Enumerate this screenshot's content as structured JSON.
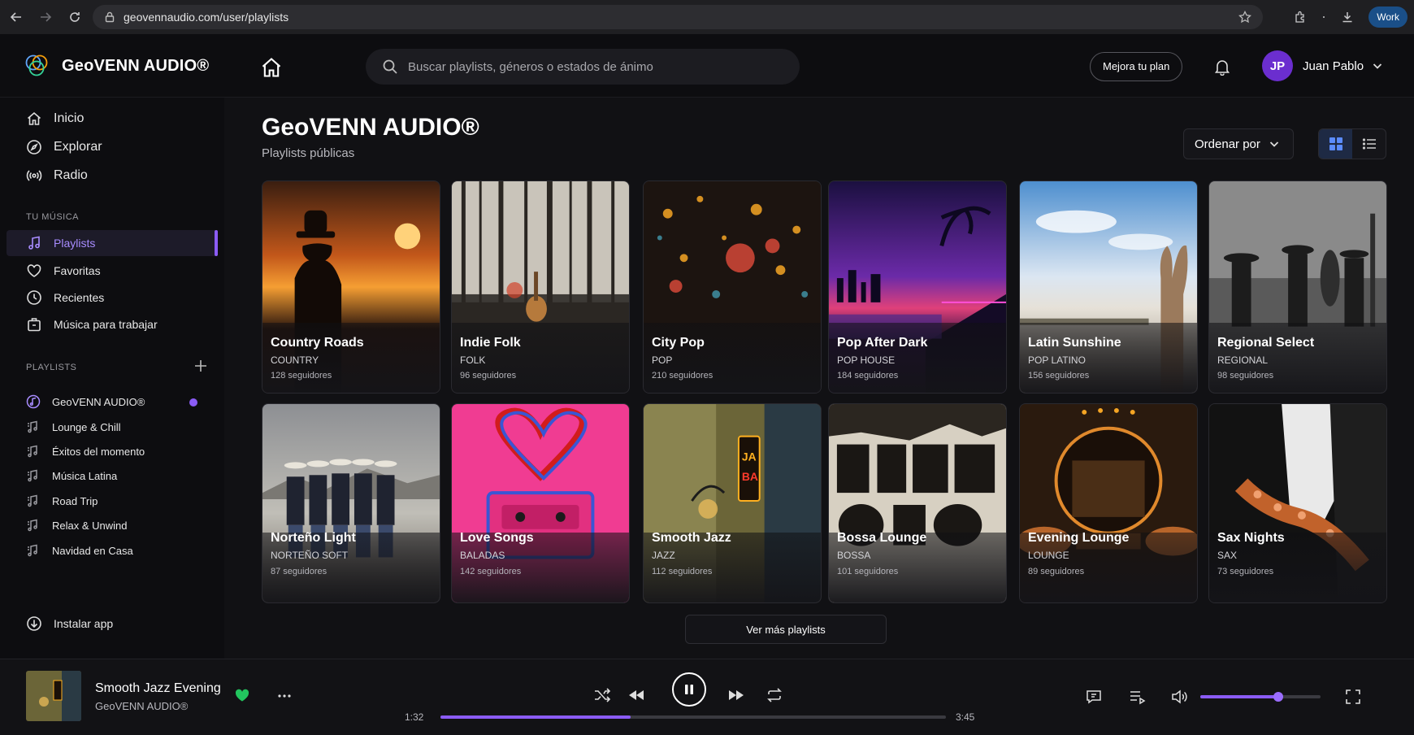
{
  "browser": {
    "url": "geovennaudio.com/user/playlists",
    "profile_label": "Work"
  },
  "header": {
    "brand": "GeoVENN AUDIO®",
    "search_placeholder": "Buscar playlists, géneros o estados de ánimo",
    "upgrade_label": "Mejora tu plan",
    "user_initials": "JP",
    "user_name": "Juan Pablo"
  },
  "sidebar": {
    "nav": [
      {
        "label": "Inicio",
        "icon": "home-icon"
      },
      {
        "label": "Explorar",
        "icon": "compass-icon"
      },
      {
        "label": "Radio",
        "icon": "radio-icon"
      }
    ],
    "section_music": "TU MÚSICA",
    "music": [
      {
        "label": "Playlists",
        "icon": "music-note-icon",
        "active": true
      },
      {
        "label": "Favoritas",
        "icon": "heart-icon"
      },
      {
        "label": "Recientes",
        "icon": "clock-icon"
      },
      {
        "label": "Música para trabajar",
        "icon": "briefcase-icon"
      }
    ],
    "section_playlists": "PLAYLISTS",
    "playlists": [
      "GeoVENN AUDIO®",
      "Lounge & Chill",
      "Éxitos del momento",
      "Música Latina",
      "Road Trip",
      "Relax & Unwind",
      "Navidad en Casa"
    ],
    "install_label": "Instalar app"
  },
  "main": {
    "title": "GeoVENN AUDIO®",
    "subtitle": "Playlists públicas",
    "sort_label": "Ordenar por",
    "more_label": "Ver más playlists",
    "cards": [
      {
        "title": "Country Roads",
        "genre": "COUNTRY",
        "followers": "128 seguidores"
      },
      {
        "title": "Indie Folk",
        "genre": "FOLK",
        "followers": "96 seguidores"
      },
      {
        "title": "City Pop",
        "genre": "POP",
        "followers": "210 seguidores"
      },
      {
        "title": "Pop After Dark",
        "genre": "POP HOUSE",
        "followers": "184 seguidores"
      },
      {
        "title": "Latin Sunshine",
        "genre": "POP LATINO",
        "followers": "156 seguidores"
      },
      {
        "title": "Regional Select",
        "genre": "REGIONAL",
        "followers": "98 seguidores"
      },
      {
        "title": "Norteño Light",
        "genre": "NORTEÑO SOFT",
        "followers": "87 seguidores"
      },
      {
        "title": "Love Songs",
        "genre": "BALADAS",
        "followers": "142 seguidores"
      },
      {
        "title": "Smooth Jazz",
        "genre": "JAZZ",
        "followers": "112 seguidores"
      },
      {
        "title": "Bossa Lounge",
        "genre": "BOSSA",
        "followers": "101 seguidores"
      },
      {
        "title": "Evening Lounge",
        "genre": "LOUNGE",
        "followers": "89 seguidores"
      },
      {
        "title": "Sax Nights",
        "genre": "SAX",
        "followers": "73 seguidores"
      }
    ]
  },
  "player": {
    "track": "Smooth Jazz Evening",
    "artist": "GeoVENN AUDIO®",
    "current_time": "1:32",
    "total_time": "3:45",
    "progress": 0.377,
    "volume": 0.65
  },
  "colors": {
    "accent": "#8b5cf6",
    "favorite": "#22c55e",
    "background": "#111114"
  }
}
